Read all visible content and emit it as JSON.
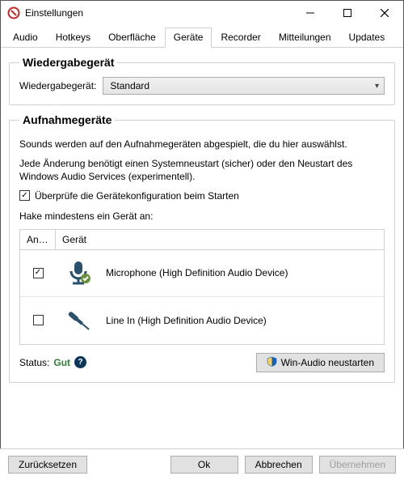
{
  "window": {
    "title": "Einstellungen"
  },
  "tabs": {
    "items": [
      "Audio",
      "Hotkeys",
      "Oberfläche",
      "Geräte",
      "Recorder",
      "Mitteilungen",
      "Updates"
    ],
    "active_index": 3
  },
  "playback": {
    "legend": "Wiedergabegerät",
    "label": "Wiedergabegerät:",
    "selected": "Standard"
  },
  "recording": {
    "legend": "Aufnahmegeräte",
    "intro": "Sounds werden auf den Aufnahmegeräten abgespielt, die du hier auswählst.",
    "note": "Jede Änderung benötigt einen Systemneustart (sicher) oder den Neustart des Windows Audio Services (experimentell).",
    "verify_label": "Überprüfe die Gerätekonfiguration beim Starten",
    "verify_checked": true,
    "list_hint": "Hake mindestens ein Gerät an:",
    "columns": {
      "enabled": "An…",
      "device": "Gerät"
    },
    "devices": [
      {
        "checked": true,
        "icon": "microphone-icon",
        "label": "Microphone (High Definition Audio Device)"
      },
      {
        "checked": false,
        "icon": "line-in-icon",
        "label": "Line In (High Definition Audio Device)"
      }
    ],
    "status_label": "Status:",
    "status_value": "Gut",
    "restart_button": "Win-Audio neustarten"
  },
  "footer": {
    "reset": "Zurücksetzen",
    "ok": "Ok",
    "cancel": "Abbrechen",
    "apply": "Übernehmen",
    "apply_enabled": false
  }
}
